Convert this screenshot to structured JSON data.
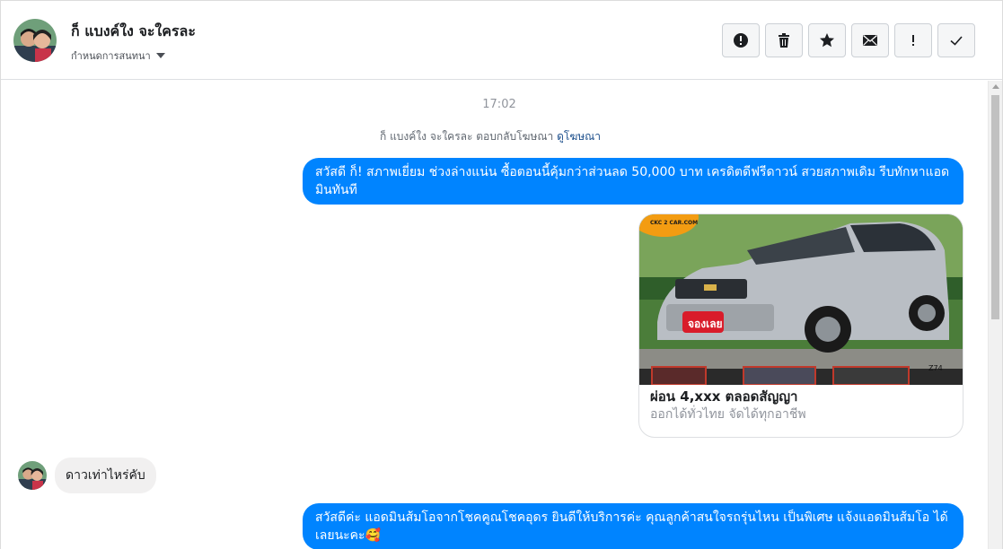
{
  "header": {
    "name": "ก็ แบงค์ใง จะใครละ",
    "subtitle": "กำหนดการสนทนา",
    "toolbar": [
      {
        "name": "report-button",
        "icon": "alert-circle-icon"
      },
      {
        "name": "delete-button",
        "icon": "trash-icon"
      },
      {
        "name": "star-button",
        "icon": "star-icon"
      },
      {
        "name": "mark-unread-button",
        "icon": "envelope-icon"
      },
      {
        "name": "important-button",
        "icon": "exclamation-icon"
      },
      {
        "name": "done-button",
        "icon": "check-icon"
      }
    ]
  },
  "thread": {
    "timestamp": "17:02",
    "ad_reply": {
      "text": "ก็ แบงค์ใง จะใครละ ตอบกลับโฆษณา",
      "link": "ดูโฆษณา"
    },
    "messages": {
      "out1": "สวัสดี ก็!  สภาพเยี่ยม ช่วงล่างแน่น  ซื้อตอนนี้คุ้มกว่าส่วนลด 50,000 บาท เครดิตดีฟรีดาวน์  สวยสภาพเดิม รีบทักหาแอดมินทันที",
      "in1": "ดาวเท่าไหร่คับ",
      "out2": "สวัสดีค่ะ แอดมินส้มโอจากโชคคูณโชคอุดร ยินดีให้บริการค่ะ   คุณลูกค้าสนใจรถรุ่นไหน เป็นพิเศษ แจ้งแอดมินส้มโอ ได้เลยนะคะ🥰"
    },
    "ad_card": {
      "title": "ผ่อน 4,xxx ตลอดสัญญา",
      "subtitle": "ออกได้ทั่วไทย จัดได้ทุกอาชีพ",
      "badge_logo": "CKC 2 CAR.COM",
      "sticker": "จองเลย",
      "code": "Z74"
    }
  },
  "colors": {
    "accent": "#0084ff",
    "incoming_bubble": "#f1f0f0",
    "link": "#1c4f8c"
  }
}
